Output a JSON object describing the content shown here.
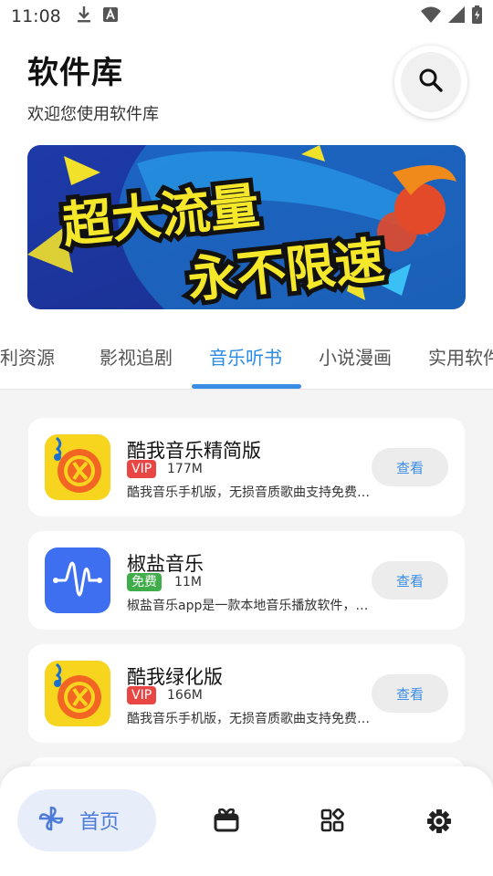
{
  "status_bar": {
    "time": "11:08",
    "icons": [
      "download-icon",
      "a-notification-icon",
      "wifi-icon",
      "signal-icon",
      "battery-icon"
    ]
  },
  "header": {
    "title": "软件库",
    "subtitle": "欢迎您使用软件库"
  },
  "banner": {
    "line1": "超大流量",
    "line2": "永不限速"
  },
  "tabs": [
    {
      "label": "福利资源"
    },
    {
      "label": "影视追剧"
    },
    {
      "label": "音乐听书",
      "active": true
    },
    {
      "label": "小说漫画"
    },
    {
      "label": "实用软件"
    }
  ],
  "apps": [
    {
      "name": "酷我音乐精简版",
      "badge": "VIP",
      "badge_color": "#e84545",
      "size": "177M",
      "desc": "酷我音乐手机版，无损音质歌曲支持免费下载",
      "icon": "kuwo-icon",
      "button": "查看"
    },
    {
      "name": "椒盐音乐",
      "badge": "免费",
      "badge_color": "#3fae4a",
      "size": "11M",
      "desc": "椒盐音乐app是一款本地音乐播放软件，界面简洁",
      "icon": "salt-music-icon",
      "button": "查看"
    },
    {
      "name": "酷我绿化版",
      "badge": "VIP",
      "badge_color": "#e84545",
      "size": "166M",
      "desc": "酷我音乐手机版，无损音质歌曲支持免费下载",
      "icon": "kuwo-icon",
      "button": "查看"
    }
  ],
  "nav": {
    "home_label": "首页",
    "items": [
      "pinwheel-icon",
      "gift-box-icon",
      "apps-grid-icon",
      "settings-gear-icon"
    ]
  },
  "colors": {
    "accent": "#2b8ce6",
    "nav_home_bg": "#e8eef9",
    "vip": "#e84545",
    "free": "#3fae4a"
  }
}
